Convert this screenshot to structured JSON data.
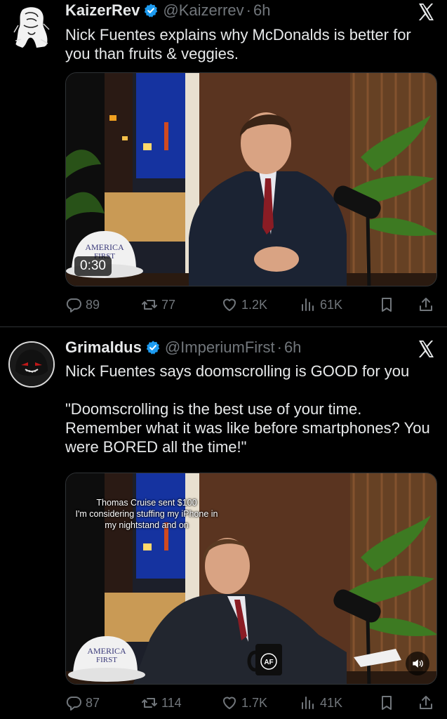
{
  "tweets": [
    {
      "display_name": "KaizerRev",
      "handle": "@Kaizerrev",
      "separator": "·",
      "time": "6h",
      "text_lines": [
        "Nick Fuentes explains why McDonalds is better for you than fruits & veggies."
      ],
      "media": {
        "duration": "0:30",
        "hat_text": [
          "AMERICA",
          "FIRST"
        ]
      },
      "stats": {
        "replies": "89",
        "reposts": "77",
        "likes": "1.2K",
        "views": "61K"
      }
    },
    {
      "display_name": "Grimaldus",
      "handle": "@ImperiumFirst",
      "separator": "·",
      "time": "6h",
      "text_lines": [
        "Nick Fuentes says doomscrolling is GOOD for you",
        "",
        "\"Doomscrolling is the best use of your time. Remember what it was like before smartphones? You were BORED all the time!\""
      ],
      "media": {
        "caption_donor": "Thomas Cruise sent $100",
        "caption_message": "I'm considering stuffing my iPhone in my nightstand and on",
        "hat_text": [
          "AMERICA",
          "FIRST"
        ],
        "mug_text": "AF"
      },
      "stats": {
        "replies": "87",
        "reposts": "114",
        "likes": "1.7K",
        "views": "41K"
      }
    }
  ],
  "icons": {
    "verified": "verified-badge-icon",
    "platform": "x-logo-icon",
    "reply": "reply-icon",
    "repost": "repost-icon",
    "like": "heart-icon",
    "views": "views-icon",
    "bookmark": "bookmark-icon",
    "share": "share-icon",
    "mute": "speaker-icon"
  },
  "colors": {
    "background": "#000000",
    "text": "#e7e9ea",
    "muted": "#71767b",
    "verified": "#1d9bf0",
    "divider": "#2f3336"
  }
}
